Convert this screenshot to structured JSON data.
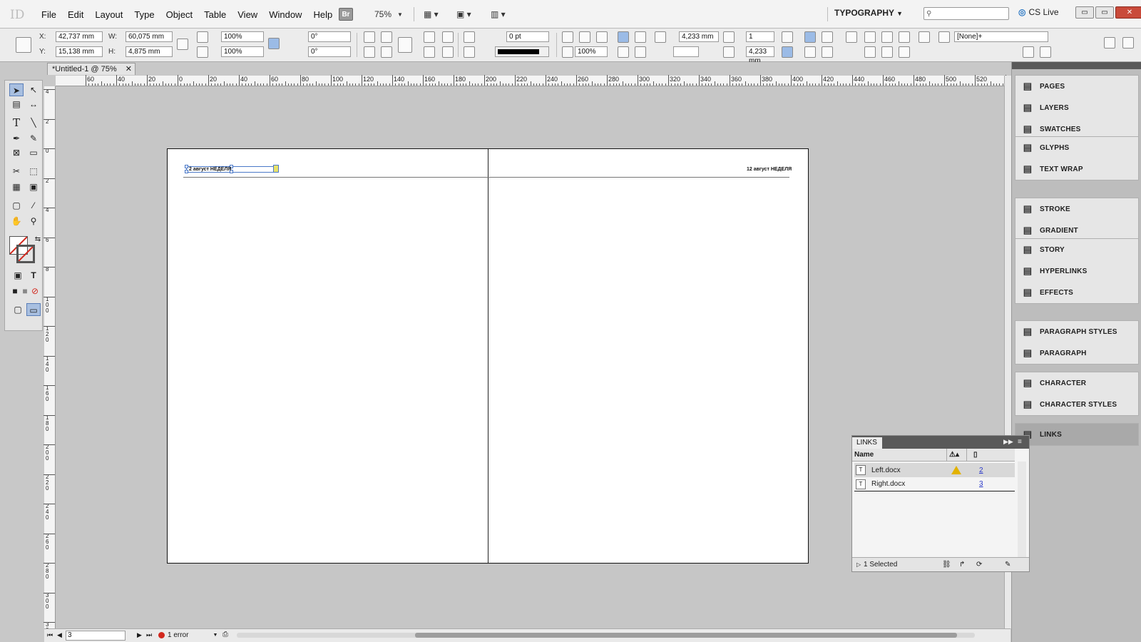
{
  "app": {
    "logo": "ID"
  },
  "menubar": {
    "menus": [
      "File",
      "Edit",
      "Layout",
      "Type",
      "Object",
      "Table",
      "View",
      "Window",
      "Help"
    ],
    "bridge": "Br",
    "zoom": "75%",
    "workspace": "TYPOGRAPHY",
    "search_placeholder": "",
    "cslive": "CS Live",
    "window_buttons": {
      "minimize": "▭",
      "restore": "▭",
      "close": "✕"
    }
  },
  "control": {
    "x_label": "X:",
    "x": "42,737 mm",
    "y_label": "Y:",
    "y": "15,138 mm",
    "w_label": "W:",
    "w": "60,075 mm",
    "h_label": "H:",
    "h": "4,875 mm",
    "scale_x": "100%",
    "scale_y": "100%",
    "rotate": "0°",
    "shear": "0°",
    "stroke_weight": "0 pt",
    "opacity": "100%",
    "gutter": "4,233 mm",
    "columns": "1",
    "col_gutter": "4,233 mm",
    "object_style": "[None]+"
  },
  "document": {
    "tab_title": "*Untitled-1 @ 75%",
    "close": "✕"
  },
  "rulers": {
    "top": [
      "60",
      "40",
      "20",
      "0",
      "20",
      "40",
      "60",
      "80",
      "100",
      "120",
      "140",
      "160",
      "180",
      "200",
      "220",
      "240",
      "260",
      "280",
      "300",
      "320",
      "340",
      "360",
      "380",
      "400",
      "420",
      "440",
      "460",
      "480",
      "500",
      "520",
      "540"
    ],
    "left": [
      "4",
      "2",
      "0",
      "2",
      "4",
      "6",
      "8",
      "1 0 0",
      "1 2 0",
      "1 4 0",
      "1 6 0",
      "1 8 0",
      "2 0 0",
      "2 2 0",
      "2 4 0",
      "2 6 0",
      "2 8 0",
      "3 0 0",
      "3 2 0"
    ]
  },
  "spread": {
    "left_header": "2 август НЕДЕЛЯ",
    "right_header": "12 август НЕДЕЛЯ"
  },
  "status": {
    "page": "3",
    "errors": "1 error"
  },
  "panels": {
    "groups": [
      [
        {
          "icon": "pages-icon",
          "label": "PAGES"
        },
        {
          "icon": "layers-icon",
          "label": "LAYERS"
        },
        {
          "icon": "swatches-icon",
          "label": "SWATCHES"
        }
      ],
      [
        {
          "icon": "glyphs-icon",
          "label": "GLYPHS"
        },
        {
          "icon": "text-wrap-icon",
          "label": "TEXT WRAP"
        }
      ],
      [
        {
          "icon": "stroke-icon",
          "label": "STROKE"
        },
        {
          "icon": "gradient-icon",
          "label": "GRADIENT"
        }
      ],
      [
        {
          "icon": "story-icon",
          "label": "STORY"
        },
        {
          "icon": "hyperlinks-icon",
          "label": "HYPERLINKS"
        },
        {
          "icon": "effects-icon",
          "label": "EFFECTS"
        }
      ],
      [
        {
          "icon": "paragraph-styles-icon",
          "label": "PARAGRAPH STYLES"
        },
        {
          "icon": "paragraph-icon",
          "label": "PARAGRAPH"
        }
      ],
      [
        {
          "icon": "character-icon",
          "label": "CHARACTER"
        },
        {
          "icon": "character-styles-icon",
          "label": "CHARACTER STYLES"
        }
      ],
      [
        {
          "icon": "links-icon",
          "label": "LINKS",
          "active": true
        }
      ]
    ]
  },
  "links_panel": {
    "title": "LINKS",
    "col_name": "Name",
    "rows": [
      {
        "name": "Left.docx",
        "page": "2",
        "warning": true,
        "selected": true
      },
      {
        "name": "Right.docx",
        "page": "3",
        "warning": false,
        "selected": false
      }
    ],
    "footer": "1 Selected"
  },
  "colors": {
    "accent": "#4a78c8",
    "error": "#d2281e",
    "warning": "#e2b200"
  }
}
